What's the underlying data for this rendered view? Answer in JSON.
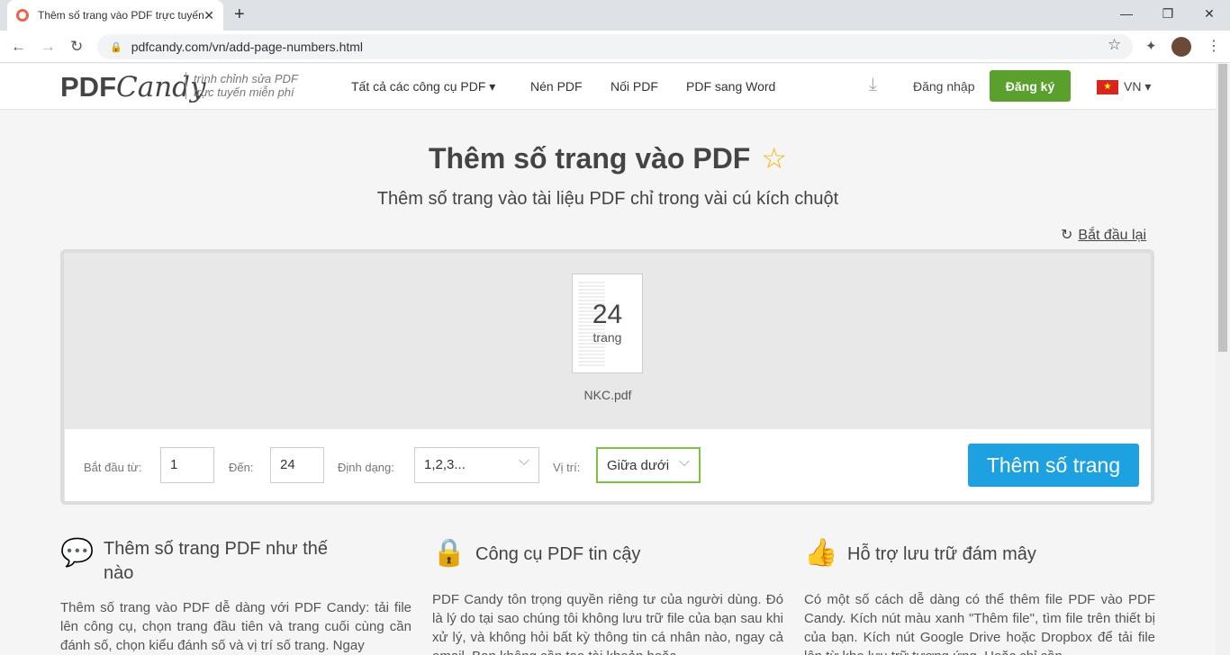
{
  "browser": {
    "tab_title": "Thêm số trang vào PDF trực tuyến",
    "url": "pdfcandy.com/vn/add-page-numbers.html"
  },
  "header": {
    "logo": "PDFCandy",
    "logo_pdf": "PDF",
    "logo_candy": "Candy",
    "tagline1": "trình chỉnh sửa PDF",
    "tagline2": "trực tuyến miễn phí",
    "nav": [
      "Tất cả các công cụ PDF ▾",
      "Nén PDF",
      "Nối PDF",
      "PDF sang Word"
    ],
    "login": "Đăng nhập",
    "signup": "Đăng ký",
    "lang": "VN ▾"
  },
  "main": {
    "title": "Thêm số trang vào PDF",
    "subtitle": "Thêm số trang vào tài liệu PDF chỉ trong vài cú kích chuột",
    "restart": "Bắt đầu lại",
    "file": {
      "pages": "24",
      "pages_label": "trang",
      "name": "NKC.pdf"
    },
    "options": {
      "start_label": "Bắt đầu từ:",
      "start": "1",
      "end_label": "Đến:",
      "end": "24",
      "format_label": "Định dạng:",
      "format": "1,2,3...",
      "position_label": "Vị trí:",
      "position": "Giữa dưới",
      "submit": "Thêm số trang"
    }
  },
  "info": [
    {
      "title": "Thêm số trang PDF như thế nào",
      "text": "Thêm số trang vào PDF dễ dàng với PDF Candy: tải file lên công cụ, chọn trang đầu tiên và trang cuối cùng cần đánh số, chọn kiểu đánh số và vị trí số trang. Ngay"
    },
    {
      "title": "Công cụ PDF tin cậy",
      "text": "PDF Candy tôn trọng quyền riêng tư của người dùng. Đó là lý do tại sao chúng tôi không lưu trữ file của bạn sau khi xử lý, và không hỏi bất kỳ thông tin cá nhân nào, ngay cả email. Bạn không cần tạo tài khoản hoặc"
    },
    {
      "title": "Hỗ trợ lưu trữ đám mây",
      "text": "Có một số cách dễ dàng có thể thêm file PDF vào PDF Candy. Kích nút màu xanh \"Thêm file\", tìm file trên thiết bị của bạn. Kích nút Google Drive hoặc Dropbox để tải file lên từ kho lưu trữ tương ứng. Hoặc chỉ cần"
    }
  ]
}
